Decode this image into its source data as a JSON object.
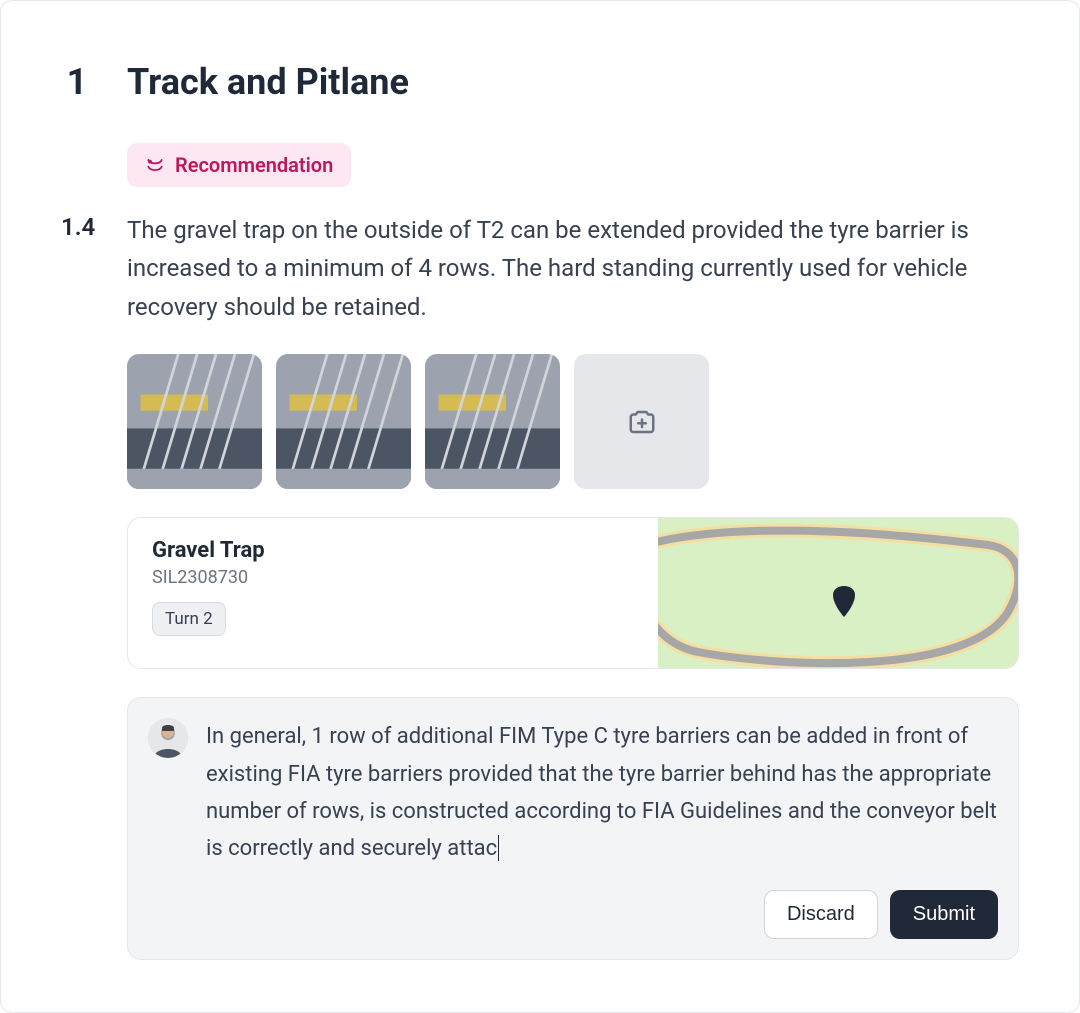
{
  "section": {
    "number": "1",
    "title": "Track and Pitlane"
  },
  "badge": {
    "label": "Recommendation",
    "icon": "racetrack-icon"
  },
  "item": {
    "number": "1.4",
    "text": "The gravel trap on the outside of T2 can be extended provided the tyre barrier is increased to a minimum of 4 rows. The hard standing currently used for vehicle recovery should be retained."
  },
  "photos": {
    "count": 3,
    "add_action": "add-photo"
  },
  "location": {
    "title": "Gravel Trap",
    "code": "SIL2308730",
    "turn_label": "Turn 2"
  },
  "comment": {
    "text": "In general, 1 row of additional FIM Type C tyre barriers can be added in front of existing FIA tyre barriers provided that the tyre barrier behind has the appropriate number of rows, is constructed according to FIA Guidelines and the conveyor belt is correctly and securely attac",
    "actions": {
      "discard": "Discard",
      "submit": "Submit"
    }
  }
}
